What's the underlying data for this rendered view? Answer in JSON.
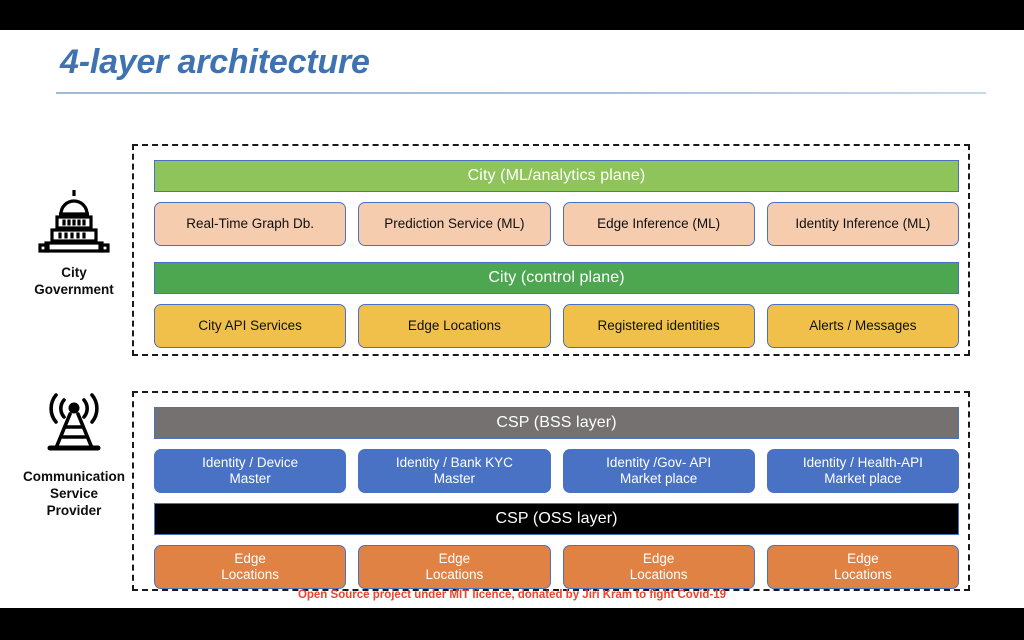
{
  "slide": {
    "title": "4-layer architecture",
    "footer": "Open Source project under MIT licence, donated by Jiri Kram to fight Covid-19"
  },
  "colors": {
    "title": "#3E72B0",
    "ml_plane_bar": "#8FC45A",
    "control_plane_bar": "#4CA750",
    "bss_layer_bar": "#757171",
    "oss_layer_bar": "#000000",
    "ml_cards": "#F5CDAE",
    "control_cards": "#F0C04A",
    "bss_cards": "#4A72C4",
    "oss_cards": "#DF8244",
    "footer_text": "#F0422A",
    "card_border": "#4A72C4",
    "group_border": "#1a1a1a"
  },
  "actors": [
    {
      "icon": "capitol-building-icon",
      "label_lines": [
        "City",
        "Government"
      ]
    },
    {
      "icon": "cell-tower-icon",
      "label_lines": [
        "Communication",
        "Service",
        "Provider"
      ]
    }
  ],
  "groups": [
    {
      "name": "city-government-group",
      "layers": [
        {
          "bar": "City (ML/analytics plane)",
          "cards": [
            {
              "line1": "Real-Time Graph Db.",
              "line2": ""
            },
            {
              "line1": "Prediction Service (ML)",
              "line2": ""
            },
            {
              "line1": "Edge Inference (ML)",
              "line2": ""
            },
            {
              "line1": "Identity Inference (ML)",
              "line2": ""
            }
          ]
        },
        {
          "bar": "City (control plane)",
          "cards": [
            {
              "line1": "City API Services",
              "line2": ""
            },
            {
              "line1": "Edge Locations",
              "line2": ""
            },
            {
              "line1": "Registered identities",
              "line2": ""
            },
            {
              "line1": "Alerts / Messages",
              "line2": ""
            }
          ]
        }
      ]
    },
    {
      "name": "communication-service-provider-group",
      "layers": [
        {
          "bar": "CSP (BSS layer)",
          "cards": [
            {
              "line1": "Identity / Device",
              "line2": "Master"
            },
            {
              "line1": "Identity / Bank KYC",
              "line2": "Master"
            },
            {
              "line1": "Identity /Gov- API",
              "line2": "Market place"
            },
            {
              "line1": "Identity / Health-API",
              "line2": "Market place"
            }
          ]
        },
        {
          "bar": "CSP (OSS layer)",
          "cards": [
            {
              "line1": "Edge",
              "line2": "Locations"
            },
            {
              "line1": "Edge",
              "line2": "Locations"
            },
            {
              "line1": "Edge",
              "line2": "Locations"
            },
            {
              "line1": "Edge",
              "line2": "Locations"
            }
          ]
        }
      ]
    }
  ]
}
